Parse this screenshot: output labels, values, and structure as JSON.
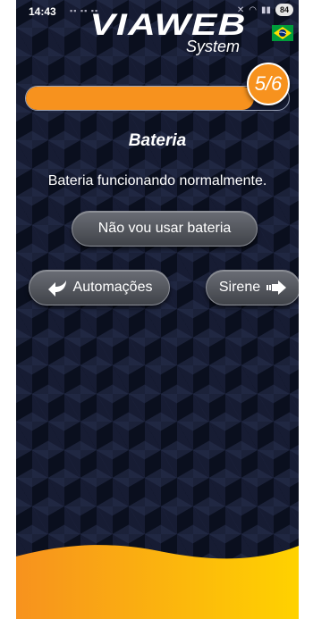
{
  "status_bar": {
    "time": "14:43",
    "network_indicators": "˙̄̂ ˙̄̂ ˙̄̂",
    "battery_level": "84"
  },
  "brand": {
    "logo_text": "VIAWEB",
    "logo_subtitle": "System",
    "flag_icon": "brazil-flag-icon"
  },
  "progress": {
    "step_label": "5/6",
    "current_step": 5,
    "total_steps": 6,
    "fraction": 0.867,
    "color": "#f7921e"
  },
  "page": {
    "title": "Bateria",
    "message": "Bateria funcionando normalmente."
  },
  "buttons": {
    "skip_label": "Não vou usar bateria",
    "back_label": "Automações",
    "back_icon": "arrow-left-icon",
    "next_label": "Sirene",
    "next_icon": "arrow-right-icon"
  },
  "colors": {
    "background": "#0a0f1e",
    "accent": "#f7921e",
    "wave_end": "#ffd200"
  }
}
